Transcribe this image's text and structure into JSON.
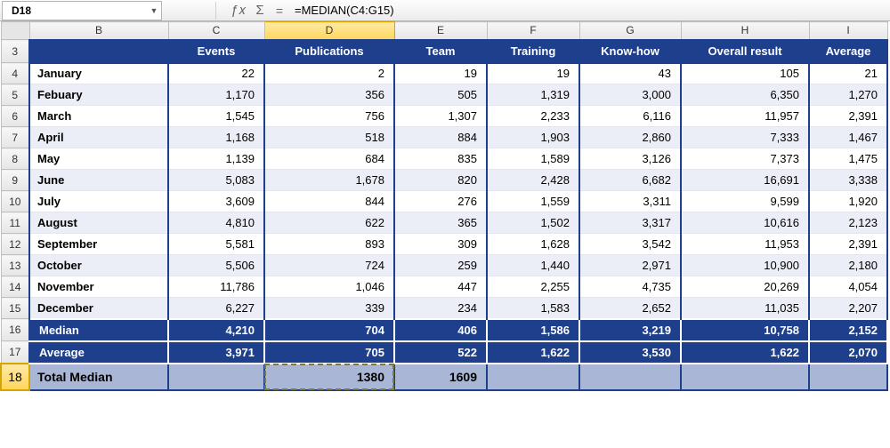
{
  "name_box": "D18",
  "formula": "=MEDIAN(C4:G15)",
  "fx_label": "f x",
  "col_letters": [
    "B",
    "C",
    "D",
    "E",
    "F",
    "G",
    "H",
    "I"
  ],
  "selected_col": "D",
  "row_numbers": [
    3,
    4,
    5,
    6,
    7,
    8,
    9,
    10,
    11,
    12,
    13,
    14,
    15,
    16,
    17,
    18
  ],
  "selected_row": 18,
  "headers": [
    "",
    "Events",
    "Publications",
    "Team",
    "Training",
    "Know-how",
    "Overall result",
    "Average"
  ],
  "rows": [
    {
      "month": "January",
      "cells": [
        "22",
        "2",
        "19",
        "19",
        "43",
        "105",
        "21"
      ]
    },
    {
      "month": "Febuary",
      "cells": [
        "1,170",
        "356",
        "505",
        "1,319",
        "3,000",
        "6,350",
        "1,270"
      ]
    },
    {
      "month": "March",
      "cells": [
        "1,545",
        "756",
        "1,307",
        "2,233",
        "6,116",
        "11,957",
        "2,391"
      ]
    },
    {
      "month": "April",
      "cells": [
        "1,168",
        "518",
        "884",
        "1,903",
        "2,860",
        "7,333",
        "1,467"
      ]
    },
    {
      "month": "May",
      "cells": [
        "1,139",
        "684",
        "835",
        "1,589",
        "3,126",
        "7,373",
        "1,475"
      ]
    },
    {
      "month": "June",
      "cells": [
        "5,083",
        "1,678",
        "820",
        "2,428",
        "6,682",
        "16,691",
        "3,338"
      ]
    },
    {
      "month": "July",
      "cells": [
        "3,609",
        "844",
        "276",
        "1,559",
        "3,311",
        "9,599",
        "1,920"
      ]
    },
    {
      "month": "August",
      "cells": [
        "4,810",
        "622",
        "365",
        "1,502",
        "3,317",
        "10,616",
        "2,123"
      ]
    },
    {
      "month": "September",
      "cells": [
        "5,581",
        "893",
        "309",
        "1,628",
        "3,542",
        "11,953",
        "2,391"
      ]
    },
    {
      "month": "October",
      "cells": [
        "5,506",
        "724",
        "259",
        "1,440",
        "2,971",
        "10,900",
        "2,180"
      ]
    },
    {
      "month": "November",
      "cells": [
        "11,786",
        "1,046",
        "447",
        "2,255",
        "4,735",
        "20,269",
        "4,054"
      ]
    },
    {
      "month": "December",
      "cells": [
        "6,227",
        "339",
        "234",
        "1,583",
        "2,652",
        "11,035",
        "2,207"
      ]
    }
  ],
  "summary": [
    {
      "label": "Median",
      "cells": [
        "4,210",
        "704",
        "406",
        "1,586",
        "3,219",
        "10,758",
        "2,152"
      ]
    },
    {
      "label": "Average",
      "cells": [
        "3,971",
        "705",
        "522",
        "1,622",
        "3,530",
        "1,622",
        "2,070"
      ]
    }
  ],
  "total_median": {
    "label": "Total Median",
    "cells": [
      "",
      "1380",
      "1609",
      "",
      "",
      "",
      ""
    ]
  },
  "active_cell_col": "D",
  "active_cell_row": 18
}
